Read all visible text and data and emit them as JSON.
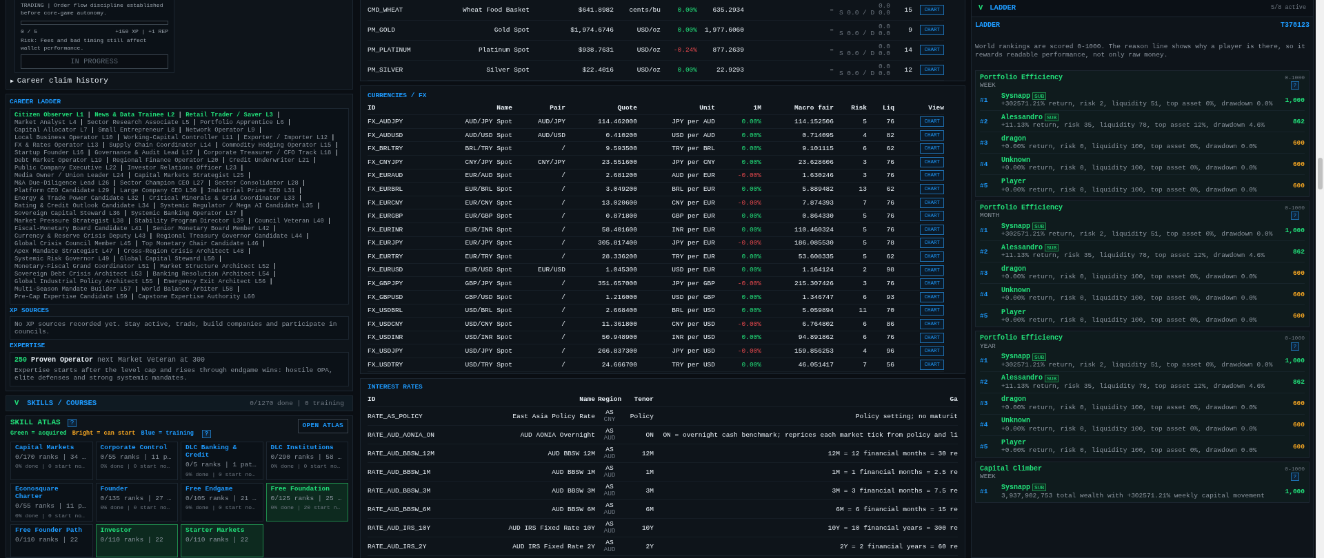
{
  "career_card": {
    "description": "TRADING | Order flow discipline established before core-game autonomy.",
    "progress": {
      "level": 0
    },
    "count": "0 / 5",
    "reward": "+150 XP | +1 REP",
    "risk": "Risk: Fees and bad timing still affect wallet performance.",
    "status_button": "IN PROGRESS"
  },
  "career_claim_history": {
    "marker": "▶",
    "label": "Career claim history"
  },
  "career_ladder": {
    "title": "CAREER LADDER",
    "separator": "|",
    "levels": [
      {
        "label": "Citizen Observer L1",
        "achieved": true
      },
      {
        "label": "News & Data Trainee L2",
        "achieved": true
      },
      {
        "label": "Retail Trader / Saver L3",
        "achieved": true
      },
      {
        "label": "Market Analyst L4",
        "achieved": false
      },
      {
        "label": "Sector Research Associate L5",
        "achieved": false
      },
      {
        "label": "Portfolio Apprentice L6",
        "achieved": false
      },
      {
        "label": "Capital Allocator L7",
        "achieved": false
      },
      {
        "label": "Small Entrepreneur L8",
        "achieved": false
      },
      {
        "label": "Network Operator L9",
        "achieved": false
      },
      {
        "label": "Local Business Operator L10",
        "achieved": false
      },
      {
        "label": "Working-Capital Controller L11",
        "achieved": false
      },
      {
        "label": "Exporter / Importer L12",
        "achieved": false
      },
      {
        "label": "FX & Rates Operator L13",
        "achieved": false
      },
      {
        "label": "Supply Chain Coordinator L14",
        "achieved": false
      },
      {
        "label": "Commodity Hedging Operator L15",
        "achieved": false
      },
      {
        "label": "Startup Founder L16",
        "achieved": false
      },
      {
        "label": "Governance & Audit Lead L17",
        "achieved": false
      },
      {
        "label": "Corporate Treasurer / CFO Track L18",
        "achieved": false
      },
      {
        "label": "Debt Market Operator L19",
        "achieved": false
      },
      {
        "label": "Regional Finance Operator L20",
        "achieved": false
      },
      {
        "label": "Credit Underwriter L21",
        "achieved": false
      },
      {
        "label": "Public Company Executive L22",
        "achieved": false
      },
      {
        "label": "Investor Relations Officer L23",
        "achieved": false
      },
      {
        "label": "Media Owner / Union Leader L24",
        "achieved": false
      },
      {
        "label": "Capital Markets Strategist L25",
        "achieved": false
      },
      {
        "label": "M&A Due-Diligence Lead L26",
        "achieved": false
      },
      {
        "label": "Sector Champion CEO L27",
        "achieved": false
      },
      {
        "label": "Sector Consolidator L28",
        "achieved": false
      },
      {
        "label": "Platform CEO Candidate L29",
        "achieved": false
      },
      {
        "label": "Large Company CEO L30",
        "achieved": false
      },
      {
        "label": "Industrial Prime CEO L31",
        "achieved": false
      },
      {
        "label": "Energy & Trade Power Candidate L32",
        "achieved": false
      },
      {
        "label": "Critical Minerals & Grid Coordinator L33",
        "achieved": false
      },
      {
        "label": "Rating & Credit Outlook Candidate L34",
        "achieved": false
      },
      {
        "label": "Systemic Regulator / Mega AI Candidate L35",
        "achieved": false
      },
      {
        "label": "Sovereign Capital Steward L36",
        "achieved": false
      },
      {
        "label": "Systemic Banking Operator L37",
        "achieved": false
      },
      {
        "label": "Market Pressure Strategist L38",
        "achieved": false
      },
      {
        "label": "Stability Program Director L39",
        "achieved": false
      },
      {
        "label": "Council Veteran L40",
        "achieved": false
      },
      {
        "label": "Fiscal-Monetary Board Candidate L41",
        "achieved": false
      },
      {
        "label": "Senior Monetary Board Member L42",
        "achieved": false
      },
      {
        "label": "Currency & Reserve Crisis Deputy L43",
        "achieved": false
      },
      {
        "label": "Regional Treasury Governor Candidate L44",
        "achieved": false
      },
      {
        "label": "Global Crisis Council Member L45",
        "achieved": false
      },
      {
        "label": "Top Monetary Chair Candidate L46",
        "achieved": false
      },
      {
        "label": "Apex Mandate Strategist L47",
        "achieved": false
      },
      {
        "label": "Cross-Region Crisis Architect L48",
        "achieved": false
      },
      {
        "label": "Systemic Risk Governor L49",
        "achieved": false
      },
      {
        "label": "Global Capital Steward L50",
        "achieved": false
      },
      {
        "label": "Monetary-Fiscal Grand Coordinator L51",
        "achieved": false
      },
      {
        "label": "Market Structure Architect L52",
        "achieved": false
      },
      {
        "label": "Sovereign Debt Crisis Architect L53",
        "achieved": false
      },
      {
        "label": "Banking Resolution Architect L54",
        "achieved": false
      },
      {
        "label": "Global Industrial Policy Architect L55",
        "achieved": false
      },
      {
        "label": "Emergency Exit Architect L56",
        "achieved": false
      },
      {
        "label": "Multi-Season Mandate Builder L57",
        "achieved": false
      },
      {
        "label": "World Balance Arbiter L58",
        "achieved": false
      },
      {
        "label": "Pre-Cap Expertise Candidate L59",
        "achieved": false
      },
      {
        "label": "Capstone Expertise Authority L60",
        "achieved": false
      }
    ]
  },
  "xp_sources": {
    "title": "XP SOURCES",
    "text": "No XP sources recorded yet. Stay active, trade, build companies and participate in councils."
  },
  "expertise": {
    "title": "EXPERTISE",
    "points": "250",
    "rank": "Proven Operator",
    "next": "next Market Veteran at 300",
    "text": "Expertise starts after the level cap and rises through endgame wins: hostile OPA, elite defenses and strong systemic mandates."
  },
  "skills": {
    "toggle": "V",
    "title": "SKILLS / COURSES",
    "summary": "0/1270 done | 0 training",
    "atlas_title": "SKILL ATLAS",
    "help": "?",
    "open_button": "OPEN ATLAS",
    "legend_help": "?",
    "legend": [
      {
        "text": "Green = acquired",
        "kind": "acquired"
      },
      {
        "text": "Bright = can start",
        "kind": "can_start"
      },
      {
        "text": "Blue = training",
        "kind": "training"
      }
    ],
    "cards": [
      {
        "title": "Capital Markets",
        "ranks": "0/170 ranks | 34 …",
        "progress": "0% done | 0 start no…",
        "acquired": false
      },
      {
        "title": "Corporate Control",
        "ranks": "0/55 ranks | 11 p…",
        "progress": "0% done | 0 start no…",
        "acquired": false
      },
      {
        "title": "DLC Banking & Credit",
        "ranks": "0/5 ranks | 1 pat…",
        "progress": "0% done | 0 start no…",
        "acquired": false
      },
      {
        "title": "DLC Institutions",
        "ranks": "0/290 ranks | 58 …",
        "progress": "0% done | 0 start no…",
        "acquired": false
      },
      {
        "title": "Econosquare Charter",
        "ranks": "0/55 ranks | 11 p…",
        "progress": "0% done | 0 start no…",
        "acquired": false
      },
      {
        "title": "Founder",
        "ranks": "0/135 ranks | 27 …",
        "progress": "0% done | 0 start no…",
        "acquired": false
      },
      {
        "title": "Free Endgame",
        "ranks": "0/105 ranks | 21 …",
        "progress": "0% done | 0 start no…",
        "acquired": false
      },
      {
        "title": "Free Foundation",
        "ranks": "0/125 ranks | 25 …",
        "progress": "0% done | 20 start n…",
        "acquired": true
      },
      {
        "title": "Free Founder Path",
        "ranks": "0/110 ranks | 22",
        "acquired": false
      },
      {
        "title": "Investor",
        "ranks": "0/110 ranks | 22",
        "acquired": true
      },
      {
        "title": "Starter Markets",
        "ranks": "0/110 ranks | 22",
        "acquired": true
      }
    ]
  },
  "commodities": {
    "rows": [
      {
        "id": "CMD_WHEAT",
        "name": "Wheat Food Basket",
        "price": "$641.8982",
        "unit": "cents/bu",
        "change": "0.00%",
        "negative": false,
        "fair": "635.2934",
        "dash": "–",
        "flow": "0.0",
        "supply_demand": "S 0.0 / D 0.0",
        "liq": "15",
        "chart_button": "CHART"
      },
      {
        "id": "PM_GOLD",
        "name": "Gold Spot",
        "price": "$1,974.6746",
        "unit": "USD/oz",
        "change": "0.00%",
        "negative": false,
        "fair": "1,977.6060",
        "dash": "–",
        "flow": "0.0",
        "supply_demand": "S 0.0 / D 0.0",
        "liq": "9",
        "chart_button": "CHART"
      },
      {
        "id": "PM_PLATINUM",
        "name": "Platinum Spot",
        "price": "$938.7631",
        "unit": "USD/oz",
        "change": "-0.24%",
        "negative": true,
        "fair": "877.2639",
        "dash": "–",
        "flow": "0.0",
        "supply_demand": "S 0.0 / D 0.0",
        "liq": "14",
        "chart_button": "CHART"
      },
      {
        "id": "PM_SILVER",
        "name": "Silver Spot",
        "price": "$22.4016",
        "unit": "USD/oz",
        "change": "0.00%",
        "negative": false,
        "fair": "22.9293",
        "dash": "–",
        "flow": "0.0",
        "supply_demand": "S 0.0 / D 0.0",
        "liq": "12",
        "chart_button": "CHART"
      }
    ]
  },
  "currencies": {
    "title": "CURRENCIES / FX",
    "columns": [
      "ID",
      "Name",
      "Pair",
      "Quote",
      "Unit",
      "1M",
      "Macro fair",
      "Risk",
      "Liq",
      "View"
    ],
    "rows": [
      {
        "id": "FX_AUDJPY",
        "name": "AUD/JPY Spot",
        "pair": "AUD/JPY",
        "quote": "114.462000",
        "unit": "JPY per AUD",
        "change": "0.00%",
        "negative": false,
        "fair": "114.152506",
        "risk": "5",
        "liq": "76",
        "chart_button": "CHART"
      },
      {
        "id": "FX_AUDUSD",
        "name": "AUD/USD Spot",
        "pair": "AUD/USD",
        "quote": "0.410200",
        "unit": "USD per AUD",
        "change": "0.00%",
        "negative": false,
        "fair": "0.714095",
        "risk": "4",
        "liq": "82",
        "chart_button": "CHART"
      },
      {
        "id": "FX_BRLTRY",
        "name": "BRL/TRY Spot",
        "pair": "/",
        "quote": "9.593500",
        "unit": "TRY per BRL",
        "change": "0.00%",
        "negative": false,
        "fair": "9.101115",
        "risk": "6",
        "liq": "62",
        "chart_button": "CHART"
      },
      {
        "id": "FX_CNYJPY",
        "name": "CNY/JPY Spot",
        "pair": "CNY/JPY",
        "quote": "23.551600",
        "unit": "JPY per CNY",
        "change": "0.00%",
        "negative": false,
        "fair": "23.628606",
        "risk": "3",
        "liq": "76",
        "chart_button": "CHART"
      },
      {
        "id": "FX_EURAUD",
        "name": "EUR/AUD Spot",
        "pair": "/",
        "quote": "2.681200",
        "unit": "AUD per EUR",
        "change": "-0.00%",
        "negative": true,
        "fair": "1.630246",
        "risk": "3",
        "liq": "76",
        "chart_button": "CHART"
      },
      {
        "id": "FX_EURBRL",
        "name": "EUR/BRL Spot",
        "pair": "/",
        "quote": "3.049200",
        "unit": "BRL per EUR",
        "change": "0.00%",
        "negative": false,
        "fair": "5.889482",
        "risk": "13",
        "liq": "62",
        "chart_button": "CHART"
      },
      {
        "id": "FX_EURCNY",
        "name": "EUR/CNY Spot",
        "pair": "/",
        "quote": "13.020600",
        "unit": "CNY per EUR",
        "change": "-0.00%",
        "negative": true,
        "fair": "7.874393",
        "risk": "7",
        "liq": "76",
        "chart_button": "CHART"
      },
      {
        "id": "FX_EURGBP",
        "name": "EUR/GBP Spot",
        "pair": "/",
        "quote": "0.871800",
        "unit": "GBP per EUR",
        "change": "0.00%",
        "negative": false,
        "fair": "0.864330",
        "risk": "5",
        "liq": "76",
        "chart_button": "CHART"
      },
      {
        "id": "FX_EURINR",
        "name": "EUR/INR Spot",
        "pair": "/",
        "quote": "58.401600",
        "unit": "INR per EUR",
        "change": "0.00%",
        "negative": false,
        "fair": "110.460324",
        "risk": "5",
        "liq": "76",
        "chart_button": "CHART"
      },
      {
        "id": "FX_EURJPY",
        "name": "EUR/JPY Spot",
        "pair": "/",
        "quote": "305.817400",
        "unit": "JPY per EUR",
        "change": "-0.00%",
        "negative": true,
        "fair": "186.085530",
        "risk": "5",
        "liq": "78",
        "chart_button": "CHART"
      },
      {
        "id": "FX_EURTRY",
        "name": "EUR/TRY Spot",
        "pair": "/",
        "quote": "28.336200",
        "unit": "TRY per EUR",
        "change": "0.00%",
        "negative": false,
        "fair": "53.608335",
        "risk": "5",
        "liq": "62",
        "chart_button": "CHART"
      },
      {
        "id": "FX_EURUSD",
        "name": "EUR/USD Spot",
        "pair": "EUR/USD",
        "quote": "1.045300",
        "unit": "USD per EUR",
        "change": "0.00%",
        "negative": false,
        "fair": "1.164124",
        "risk": "2",
        "liq": "98",
        "chart_button": "CHART"
      },
      {
        "id": "FX_GBPJPY",
        "name": "GBP/JPY Spot",
        "pair": "/",
        "quote": "351.657000",
        "unit": "JPY per GBP",
        "change": "-0.00%",
        "negative": true,
        "fair": "215.307426",
        "risk": "3",
        "liq": "76",
        "chart_button": "CHART"
      },
      {
        "id": "FX_GBPUSD",
        "name": "GBP/USD Spot",
        "pair": "/",
        "quote": "1.216000",
        "unit": "USD per GBP",
        "change": "0.00%",
        "negative": false,
        "fair": "1.346747",
        "risk": "6",
        "liq": "93",
        "chart_button": "CHART"
      },
      {
        "id": "FX_USDBRL",
        "name": "USD/BRL Spot",
        "pair": "/",
        "quote": "2.668400",
        "unit": "BRL per USD",
        "change": "0.00%",
        "negative": false,
        "fair": "5.059894",
        "risk": "11",
        "liq": "70",
        "chart_button": "CHART"
      },
      {
        "id": "FX_USDCNY",
        "name": "USD/CNY Spot",
        "pair": "/",
        "quote": "11.361800",
        "unit": "CNY per USD",
        "change": "-0.00%",
        "negative": true,
        "fair": "6.764802",
        "risk": "6",
        "liq": "86",
        "chart_button": "CHART"
      },
      {
        "id": "FX_USDINR",
        "name": "USD/INR Spot",
        "pair": "/",
        "quote": "50.948900",
        "unit": "INR per USD",
        "change": "0.00%",
        "negative": false,
        "fair": "94.891862",
        "risk": "6",
        "liq": "76",
        "chart_button": "CHART"
      },
      {
        "id": "FX_USDJPY",
        "name": "USD/JPY Spot",
        "pair": "/",
        "quote": "266.837300",
        "unit": "JPY per USD",
        "change": "-0.00%",
        "negative": true,
        "fair": "159.856253",
        "risk": "4",
        "liq": "96",
        "chart_button": "CHART"
      },
      {
        "id": "FX_USDTRY",
        "name": "USD/TRY Spot",
        "pair": "/",
        "quote": "24.666700",
        "unit": "TRY per USD",
        "change": "0.00%",
        "negative": false,
        "fair": "46.051417",
        "risk": "7",
        "liq": "56",
        "chart_button": "CHART"
      }
    ]
  },
  "interest_rates": {
    "title": "INTEREST RATES",
    "columns": [
      "ID",
      "Name",
      "Region",
      "Tenor",
      "Ga"
    ],
    "rows": [
      {
        "id": "RATE_AS_POLICY",
        "name": "East Asia Policy Rate",
        "region": "AS",
        "currency": "CNY",
        "tenor": "Policy",
        "column_5": "Policy setting; no maturit"
      },
      {
        "id": "RATE_AUD_AONIA_ON",
        "name": "AUD AONIA Overnight",
        "region": "AS",
        "currency": "AUD",
        "tenor": "ON",
        "column_5": "ON = overnight cash benchmark; reprices each market tick from policy and li"
      },
      {
        "id": "RATE_AUD_BBSW_12M",
        "name": "AUD BBSW 12M",
        "region": "AS",
        "currency": "AUD",
        "tenor": "12M",
        "column_5": "12M = 12 financial months = 30 re"
      },
      {
        "id": "RATE_AUD_BBSW_1M",
        "name": "AUD BBSW 1M",
        "region": "AS",
        "currency": "AUD",
        "tenor": "1M",
        "column_5": "1M = 1 financial months = 2.5 re"
      },
      {
        "id": "RATE_AUD_BBSW_3M",
        "name": "AUD BBSW 3M",
        "region": "AS",
        "currency": "AUD",
        "tenor": "3M",
        "column_5": "3M = 3 financial months = 7.5 re"
      },
      {
        "id": "RATE_AUD_BBSW_6M",
        "name": "AUD BBSW 6M",
        "region": "AS",
        "currency": "AUD",
        "tenor": "6M",
        "column_5": "6M = 6 financial months = 15 re"
      },
      {
        "id": "RATE_AUD_IRS_10Y",
        "name": "AUD IRS Fixed Rate 10Y",
        "region": "AS",
        "currency": "AUD",
        "tenor": "10Y",
        "column_5": "10Y = 10 financial years = 300 re"
      },
      {
        "id": "RATE_AUD_IRS_2Y",
        "name": "AUD IRS Fixed Rate 2Y",
        "region": "AS",
        "currency": "AUD",
        "tenor": "2Y",
        "column_5": "2Y = 2 financial years = 60 re"
      }
    ]
  },
  "ladder": {
    "toggle": "V",
    "title": "LADDER",
    "summary": "5/8 active",
    "subtitle": "LADDER",
    "tick": "T378123",
    "description": "World rankings are scored 0-1000. The reason line shows why a player is there, so it rewards readable performance, not only raw money.",
    "groups": [
      {
        "title": "Portfolio Efficiency",
        "period": "WEEK",
        "range": "0-1000",
        "help": "?",
        "rows": [
          {
            "rank": "#1",
            "name": "Sysnapp",
            "badge": "SUB",
            "reason": "+302571.21% return, risk 2, liquidity 51, top asset 0%, drawdown 0.0%",
            "score": "1,000",
            "color": "#22e07a"
          },
          {
            "rank": "#2",
            "name": "Alessandro",
            "badge": "SUB",
            "reason": "+11.13% return, risk 35, liquidity 78, top asset 12%, drawdown 4.6%",
            "score": "862",
            "color": "#22e07a"
          },
          {
            "rank": "#3",
            "name": "dragon",
            "reason": "+0.00% return, risk 0, liquidity 100, top asset 0%, drawdown 0.0%",
            "score": "600",
            "color": "#f5a623"
          },
          {
            "rank": "#4",
            "name": "Unknown",
            "reason": "+0.00% return, risk 0, liquidity 100, top asset 0%, drawdown 0.0%",
            "score": "600",
            "color": "#f5a623"
          },
          {
            "rank": "#5",
            "name": "Player",
            "reason": "+0.00% return, risk 0, liquidity 100, top asset 0%, drawdown 0.0%",
            "score": "600",
            "color": "#f5a623"
          }
        ]
      },
      {
        "title": "Portfolio Efficiency",
        "period": "MONTH",
        "range": "0-1000",
        "help": "?",
        "rows": [
          {
            "rank": "#1",
            "name": "Sysnapp",
            "badge": "SUB",
            "reason": "+302571.21% return, risk 2, liquidity 51, top asset 0%, drawdown 0.0%",
            "score": "1,000",
            "color": "#22e07a"
          },
          {
            "rank": "#2",
            "name": "Alessandro",
            "badge": "SUB",
            "reason": "+11.13% return, risk 35, liquidity 78, top asset 12%, drawdown 4.6%",
            "score": "862",
            "color": "#22e07a"
          },
          {
            "rank": "#3",
            "name": "dragon",
            "reason": "+0.00% return, risk 0, liquidity 100, top asset 0%, drawdown 0.0%",
            "score": "600",
            "color": "#f5a623"
          },
          {
            "rank": "#4",
            "name": "Unknown",
            "reason": "+0.00% return, risk 0, liquidity 100, top asset 0%, drawdown 0.0%",
            "score": "600",
            "color": "#f5a623"
          },
          {
            "rank": "#5",
            "name": "Player",
            "reason": "+0.00% return, risk 0, liquidity 100, top asset 0%, drawdown 0.0%",
            "score": "600",
            "color": "#f5a623"
          }
        ]
      },
      {
        "title": "Portfolio Efficiency",
        "period": "YEAR",
        "range": "0-1000",
        "help": "?",
        "rows": [
          {
            "rank": "#1",
            "name": "Sysnapp",
            "badge": "SUB",
            "reason": "+302571.21% return, risk 2, liquidity 51, top asset 0%, drawdown 0.0%",
            "score": "1,000",
            "color": "#22e07a"
          },
          {
            "rank": "#2",
            "name": "Alessandro",
            "badge": "SUB",
            "reason": "+11.13% return, risk 35, liquidity 78, top asset 12%, drawdown 4.6%",
            "score": "862",
            "color": "#22e07a"
          },
          {
            "rank": "#3",
            "name": "dragon",
            "reason": "+0.00% return, risk 0, liquidity 100, top asset 0%, drawdown 0.0%",
            "score": "600",
            "color": "#f5a623"
          },
          {
            "rank": "#4",
            "name": "Unknown",
            "reason": "+0.00% return, risk 0, liquidity 100, top asset 0%, drawdown 0.0%",
            "score": "600",
            "color": "#f5a623"
          },
          {
            "rank": "#5",
            "name": "Player",
            "reason": "+0.00% return, risk 0, liquidity 100, top asset 0%, drawdown 0.0%",
            "score": "600",
            "color": "#f5a623"
          }
        ]
      },
      {
        "title": "Capital Climber",
        "period": "WEEK",
        "range": "0-1000",
        "help": "?",
        "rows": [
          {
            "rank": "#1",
            "name": "Sysnapp",
            "badge": "SUB",
            "reason": "3,937,902,753 total wealth with +302571.21% weekly capital movement",
            "score": "1,000",
            "color": "#22e07a"
          }
        ]
      }
    ]
  }
}
